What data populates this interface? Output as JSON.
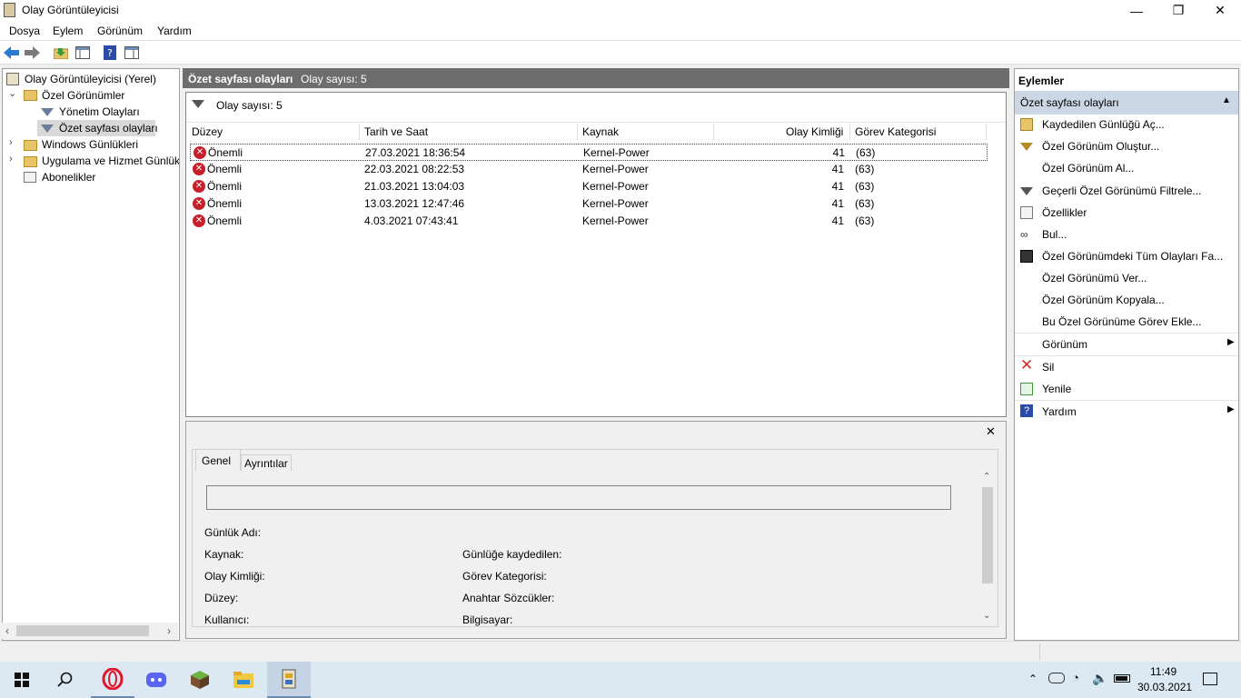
{
  "window": {
    "title": "Olay Görüntüleyicisi",
    "minimize": "—",
    "maximize": "❐",
    "close": "✕"
  },
  "menu": [
    "Dosya",
    "Eylem",
    "Görünüm",
    "Yardım"
  ],
  "tree": {
    "root": "Olay Görüntüleyicisi (Yerel)",
    "custom_views": "Özel Görünümler",
    "admin_events": "Yönetim Olayları",
    "summary_events": "Özet sayfası olayları",
    "windows_logs": "Windows Günlükleri",
    "app_service_logs": "Uygulama ve Hizmet Günlük",
    "subscriptions": "Abonelikler"
  },
  "center": {
    "header_title": "Özet sayfası olayları",
    "header_count": "Olay sayısı: 5",
    "filter_text": "Olay sayısı: 5",
    "columns": [
      "Düzey",
      "Tarih ve Saat",
      "Kaynak",
      "Olay Kimliği",
      "Görev Kategorisi"
    ],
    "rows": [
      {
        "level": "Önemli",
        "datetime": "27.03.2021 18:36:54",
        "source": "Kernel-Power",
        "id": "41",
        "category": "(63)"
      },
      {
        "level": "Önemli",
        "datetime": "22.03.2021 08:22:53",
        "source": "Kernel-Power",
        "id": "41",
        "category": "(63)"
      },
      {
        "level": "Önemli",
        "datetime": "21.03.2021 13:04:03",
        "source": "Kernel-Power",
        "id": "41",
        "category": "(63)"
      },
      {
        "level": "Önemli",
        "datetime": "13.03.2021 12:47:46",
        "source": "Kernel-Power",
        "id": "41",
        "category": "(63)"
      },
      {
        "level": "Önemli",
        "datetime": "4.03.2021 07:43:41",
        "source": "Kernel-Power",
        "id": "41",
        "category": "(63)"
      }
    ]
  },
  "detail": {
    "tabs": [
      "Genel",
      "Ayrıntılar"
    ],
    "close": "✕",
    "fields": {
      "log_name": "Günlük Adı:",
      "source": "Kaynak:",
      "logged": "Günlüğe kaydedilen:",
      "event_id": "Olay Kimliği:",
      "task_category": "Görev Kategorisi:",
      "level": "Düzey:",
      "keywords": "Anahtar Sözcükler:",
      "user": "Kullanıcı:",
      "computer": "Bilgisayar:"
    }
  },
  "actions": {
    "title": "Eylemler",
    "section": "Özet sayfası olayları",
    "items": [
      "Kaydedilen Günlüğü Aç...",
      "Özel Görünüm Oluştur...",
      "Özel Görünüm Al...",
      "Geçerli Özel Görünümü Filtrele...",
      "Özellikler",
      "Bul...",
      "Özel Görünümdeki Tüm Olayları Fa...",
      "Özel Görünümü Ver...",
      "Özel Görünüm Kopyala...",
      "Bu Özel Görünüme Görev Ekle...",
      "Görünüm",
      "Sil",
      "Yenile",
      "Yardım"
    ]
  },
  "taskbar": {
    "time": "11:49",
    "date": "30.03.2021"
  }
}
